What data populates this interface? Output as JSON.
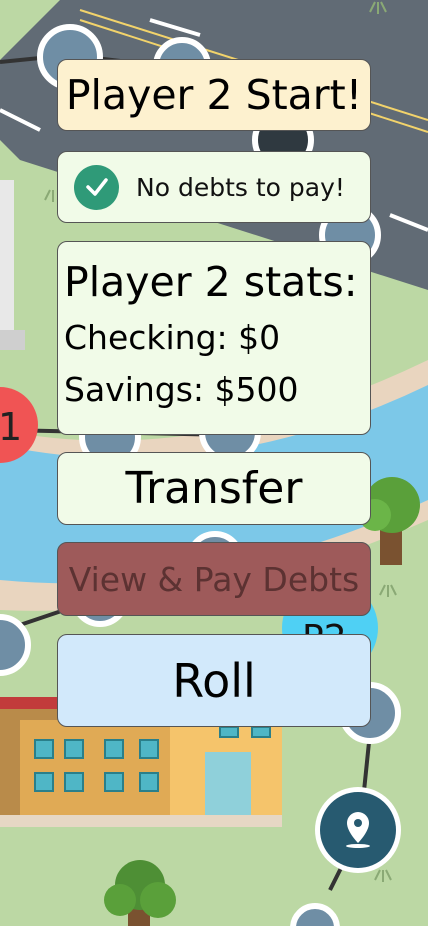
{
  "board": {
    "player1_token": "1",
    "player2_token": "P2",
    "colors": {
      "grass": "#bcd8a4",
      "road": "#616b75",
      "river": "#7cc8e8",
      "space": "#6f8ea5",
      "player1": "#f05454",
      "player2": "#4fd0f4",
      "location_marker": "#275a70"
    },
    "icons": [
      "location-pin-icon",
      "tree-icon",
      "building-icon",
      "bank-icon"
    ]
  },
  "banner": {
    "text": "Player 2 Start!"
  },
  "debt_status": {
    "icon": "checkmark-icon",
    "text": "No debts to pay!"
  },
  "stats": {
    "title": "Player 2 stats:",
    "checking_label": "Checking: $0",
    "savings_label": "Savings: $500"
  },
  "actions": {
    "transfer_label": "Transfer",
    "view_debts_label": "View & Pay Debts",
    "roll_label": "Roll"
  }
}
